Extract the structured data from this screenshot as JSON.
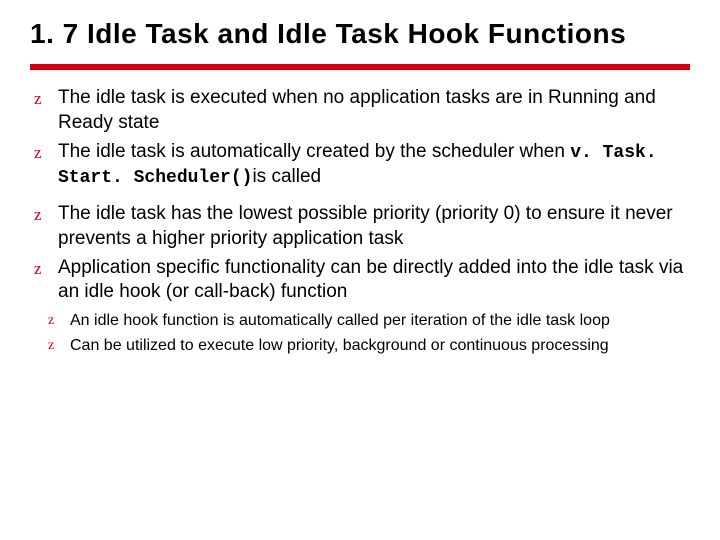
{
  "title": "1. 7 Idle Task and Idle Task Hook Functions",
  "bullets": [
    {
      "text": "The idle task is executed when no application tasks are in Running and Ready state"
    },
    {
      "prefix": "The idle task is automatically created by the scheduler when ",
      "code": "v. Task. Start. Scheduler()",
      "suffix": "is called"
    },
    {
      "text": "The idle task has the lowest possible priority (priority 0) to ensure it never prevents a higher priority application task"
    },
    {
      "text": "Application specific functionality can be directly added into the idle task via an idle hook (or call-back) function"
    }
  ],
  "sub_bullets": [
    {
      "text": "An idle hook function is automatically called per iteration of the idle task loop"
    },
    {
      "text": "Can be utilized to execute low priority, background or continuous processing"
    }
  ]
}
